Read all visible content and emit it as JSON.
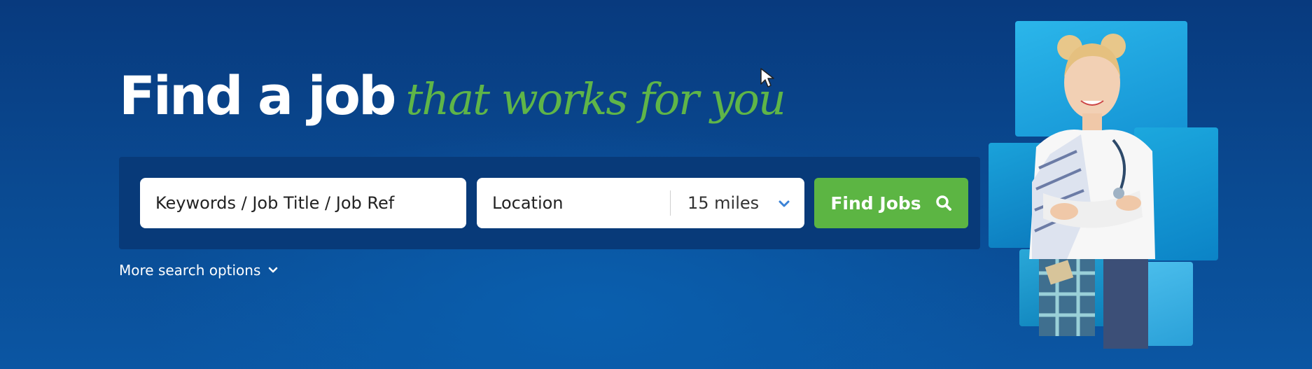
{
  "hero": {
    "title_main": "Find a job",
    "title_accent": "that works for you"
  },
  "search": {
    "keywords_placeholder": "Keywords / Job Title / Job Ref",
    "location_placeholder": "Location",
    "radius_selected": "15 miles",
    "submit_label": "Find Jobs"
  },
  "more_options_label": "More search options",
  "icons": {
    "search": "search-icon",
    "chevron": "chevron-down-icon",
    "cursor": "mouse-cursor-icon"
  },
  "colors": {
    "brand_blue": "#0a4b93",
    "accent_green": "#5cb543",
    "chevron_blue": "#3b82d6"
  }
}
